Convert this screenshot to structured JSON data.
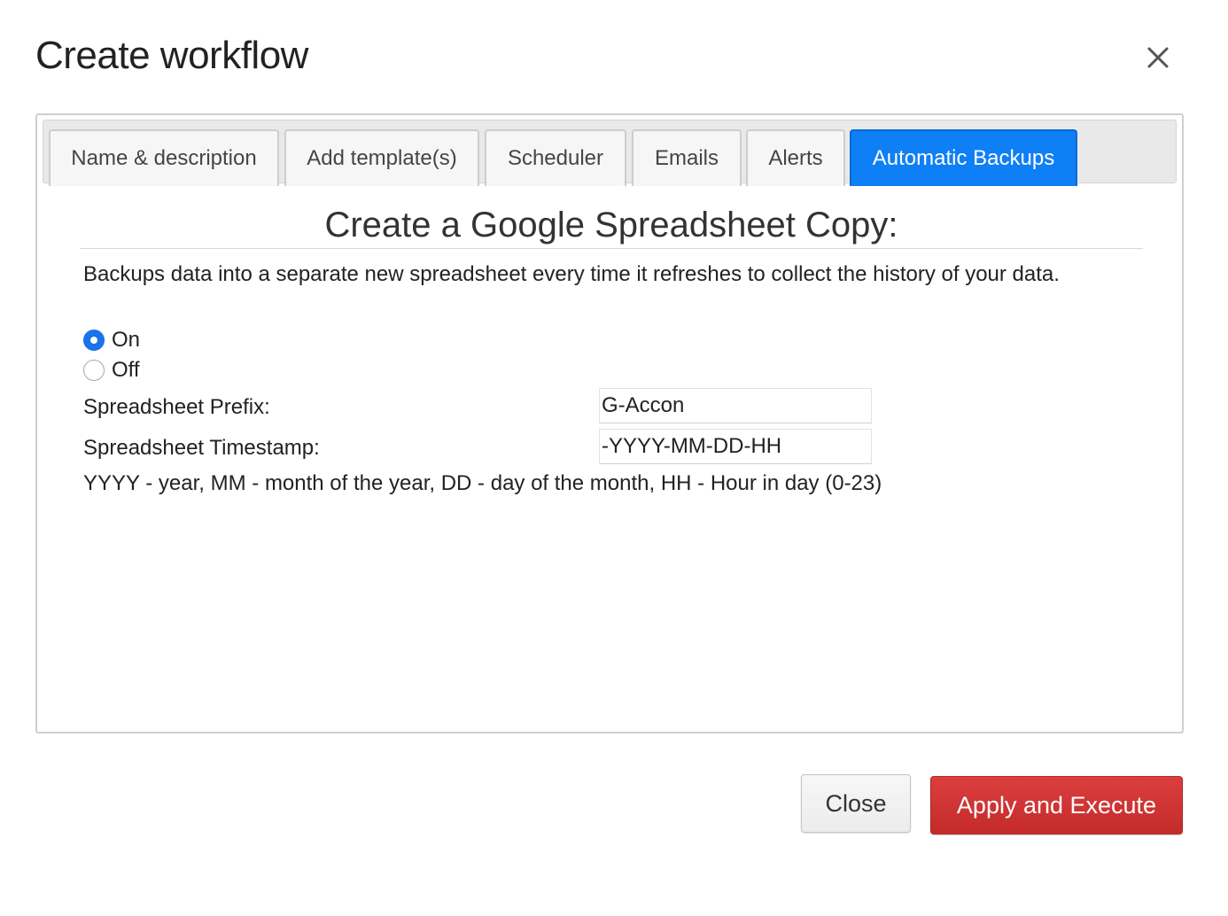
{
  "dialog": {
    "title": "Create workflow",
    "close_icon": "close-icon"
  },
  "tabs": [
    {
      "label": "Name & description",
      "active": false
    },
    {
      "label": "Add template(s)",
      "active": false
    },
    {
      "label": "Scheduler",
      "active": false
    },
    {
      "label": "Emails",
      "active": false
    },
    {
      "label": "Alerts",
      "active": false
    },
    {
      "label": "Automatic Backups",
      "active": true
    }
  ],
  "backup": {
    "heading": "Create a Google Spreadsheet Copy:",
    "description": "Backups data into a separate new spreadsheet every time it refreshes to collect the history of your data.",
    "options": [
      {
        "label": "On",
        "checked": true
      },
      {
        "label": "Off",
        "checked": false
      }
    ],
    "prefix_label": "Spreadsheet Prefix:",
    "prefix_value": "G-Accon",
    "timestamp_label": "Spreadsheet Timestamp:",
    "timestamp_value": "-YYYY-MM-DD-HH",
    "hint": "YYYY - year, MM - month of the year, DD - day of the month, HH - Hour in day (0-23)"
  },
  "footer": {
    "close_label": "Close",
    "apply_label": "Apply and Execute"
  },
  "colors": {
    "active_tab": "#0f7ff5",
    "radio_checked": "#1a73e8",
    "apply_button": "#d03535"
  }
}
